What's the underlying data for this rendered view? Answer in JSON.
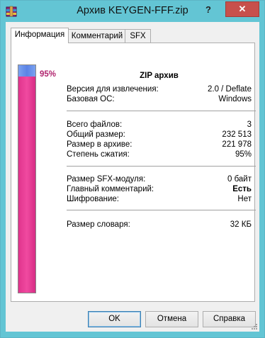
{
  "window": {
    "title": "Архив KEYGEN-FFF.zip",
    "help_label": "?",
    "close_label": "✕",
    "accent": "#63c5d4",
    "close_color": "#c7504c"
  },
  "tabs": [
    {
      "label": "Информация",
      "active": true
    },
    {
      "label": "Комментарий",
      "active": false
    },
    {
      "label": "SFX",
      "active": false
    }
  ],
  "progress": {
    "ratio_label": "95%",
    "fill_percent": 95,
    "fill_color": "#e0338c",
    "rest_color": "#5b83e6"
  },
  "archive_type": "ZIP архив",
  "group1": [
    {
      "key": "Версия для извлечения:",
      "value": "2.0 / Deflate"
    },
    {
      "key": "Базовая ОС:",
      "value": "Windows"
    }
  ],
  "group2": [
    {
      "key": "Всего файлов:",
      "value": "3"
    },
    {
      "key": "Общий размер:",
      "value": "232 513"
    },
    {
      "key": "Размер в архиве:",
      "value": "221 978"
    },
    {
      "key": "Степень сжатия:",
      "value": "95%"
    }
  ],
  "group3": [
    {
      "key": "Размер SFX-модуля:",
      "value": "0 байт"
    },
    {
      "key": "Главный комментарий:",
      "value": "Есть"
    },
    {
      "key": "Шифрование:",
      "value": "Нет"
    }
  ],
  "group4": [
    {
      "key": "Размер словаря:",
      "value": "32 КБ"
    }
  ],
  "buttons": {
    "ok": "OK",
    "cancel": "Отмена",
    "help": "Справка"
  },
  "icons": {
    "app": "winrar-archive-icon",
    "grip": "resize-grip-icon"
  }
}
